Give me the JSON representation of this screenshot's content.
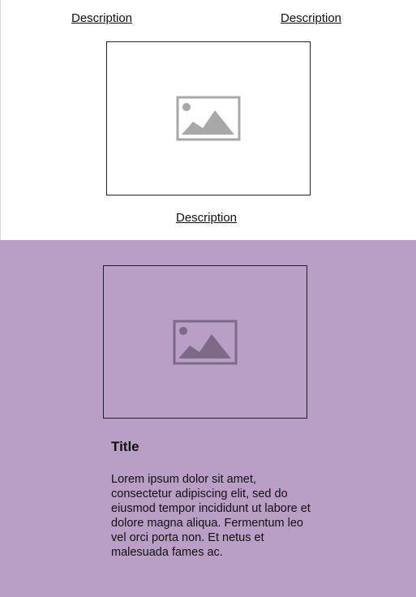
{
  "top_section": {
    "links": {
      "left": "Description",
      "right": "Description",
      "center": "Description"
    },
    "image": {
      "icon": "image-placeholder-icon"
    }
  },
  "bottom_section": {
    "background_color": "#b99fc5",
    "image": {
      "icon": "image-placeholder-icon"
    },
    "card": {
      "title": "Title",
      "body": "Lorem ipsum dolor sit amet, consectetur adipiscing elit, sed do eiusmod tempor incididunt ut labore et dolore magna aliqua. Fermentum leo vel orci porta non. Et netus et malesuada fames ac."
    }
  }
}
